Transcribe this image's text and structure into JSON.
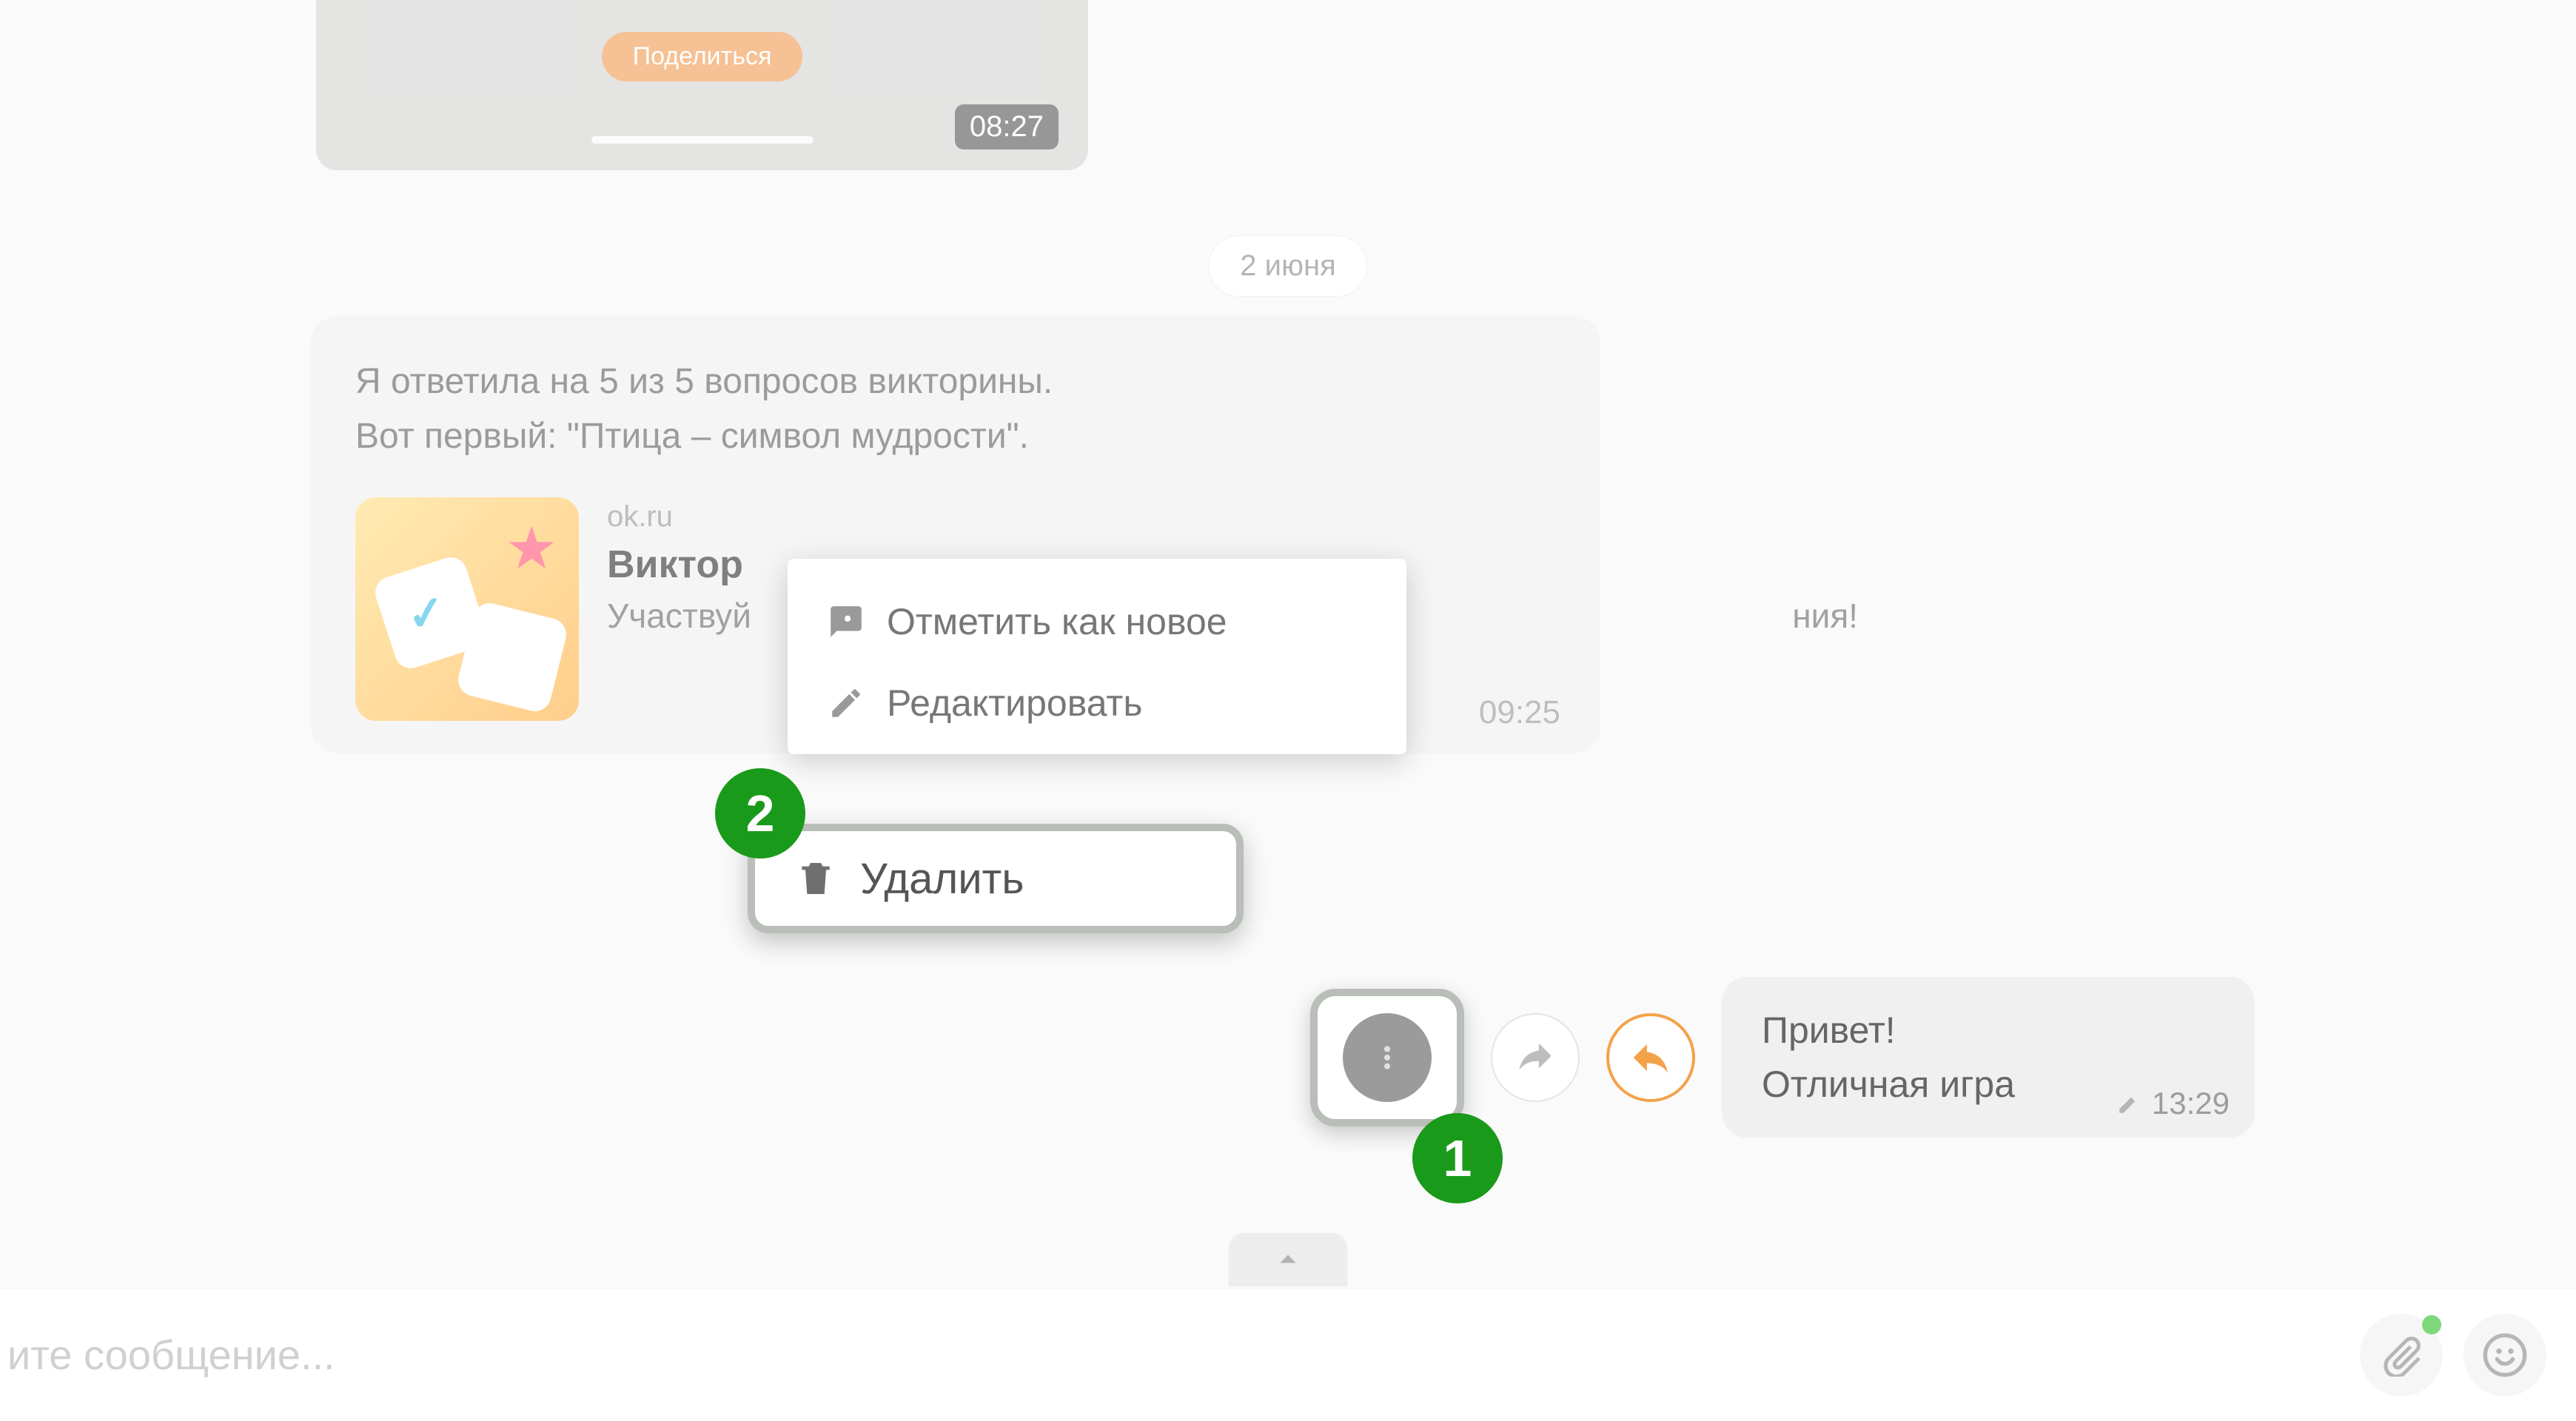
{
  "top_card": {
    "share_label": "Поделиться",
    "time": "08:27"
  },
  "date_separator": "2 июня",
  "incoming": {
    "text_line1": "Я ответила на 5 из 5 вопросов викторины.",
    "text_line2": "Вот первый: \"Птица – символ мудрости\".",
    "link": {
      "domain": "ok.ru",
      "title": "Виктор",
      "desc_prefix": "Участвуй",
      "desc_suffix": "ния!"
    },
    "time": "09:25"
  },
  "context_menu": {
    "mark_new": "Отметить как новое",
    "edit": "Редактировать",
    "delete": "Удалить"
  },
  "badges": {
    "one": "1",
    "two": "2"
  },
  "outgoing": {
    "line1": "Привет!",
    "line2": "Отличная игра",
    "time": "13:29"
  },
  "composer": {
    "placeholder": "ите сообщение..."
  }
}
